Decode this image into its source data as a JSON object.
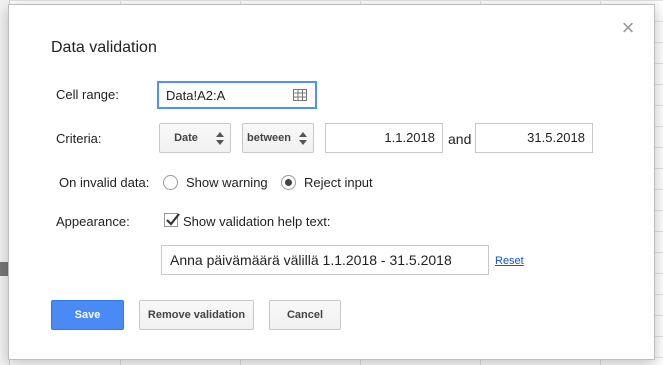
{
  "dialog": {
    "title": "Data validation",
    "close_icon": "×"
  },
  "cell_range": {
    "label": "Cell range:",
    "value": "Data!A2:A",
    "icon": "grid-select-icon"
  },
  "criteria": {
    "label": "Criteria:",
    "type": "Date",
    "condition": "between",
    "from": "1.1.2018",
    "and_label": "and",
    "to": "31.5.2018"
  },
  "on_invalid": {
    "label": "On invalid data:",
    "options": [
      "Show warning",
      "Reject input"
    ],
    "selected": "Reject input"
  },
  "appearance": {
    "label": "Appearance:",
    "checkbox_label": "Show validation help text:",
    "checked": true,
    "help_text": "Anna päivämäärä välillä 1.1.2018 - 31.5.2018",
    "reset_label": "Reset"
  },
  "buttons": {
    "save": "Save",
    "remove": "Remove validation",
    "cancel": "Cancel"
  },
  "colors": {
    "primary": "#4a8af4",
    "focus_border": "#4d90fe",
    "link": "#1155cc"
  }
}
